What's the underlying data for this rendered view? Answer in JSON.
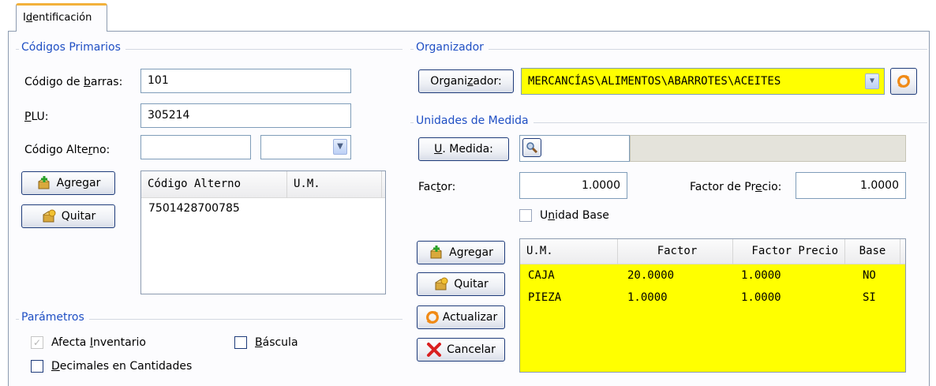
{
  "tab": {
    "label_pre": "I",
    "label_ul": "d",
    "label_post": "entificación"
  },
  "codigos": {
    "title": "Códigos Primarios",
    "barcode_label_pre": "Código de ",
    "barcode_label_ul": "b",
    "barcode_label_post": "arras:",
    "barcode_value": "101",
    "plu_label_pre": "",
    "plu_label_ul": "P",
    "plu_label_post": "LU:",
    "plu_value": "305214",
    "alt_label_pre": "Código Alte",
    "alt_label_ul": "r",
    "alt_label_post": "no:",
    "alt_value": "",
    "alt_um_value": "",
    "add_label": "Agregar",
    "remove_label": "Quitar",
    "alt_list": {
      "headers": [
        "Código Alterno",
        "U.M."
      ],
      "rows": [
        [
          "7501428700785",
          ""
        ]
      ]
    }
  },
  "parametros": {
    "title": "Parámetros",
    "afecta_pre": "Afecta ",
    "afecta_ul": "I",
    "afecta_post": "nventario",
    "afecta_checked": true,
    "bascula_ul": "B",
    "bascula_post": "áscula",
    "bascula_checked": false,
    "decimales_ul": "D",
    "decimales_post": "ecimales en Cantidades",
    "decimales_checked": false
  },
  "organizador": {
    "title": "Organizador",
    "button_pre": "Organi",
    "button_ul": "z",
    "button_post": "ador:",
    "value": "MERCANCÍAS\\ALIMENTOS\\ABARROTES\\ACEITES"
  },
  "unidades": {
    "title": "Unidades de Medida",
    "um_button_ul": "U",
    "um_button_post": ". Medida:",
    "um_value": "",
    "factor_pre": "Fac",
    "factor_ul": "t",
    "factor_post": "or:",
    "factor_value": "1.0000",
    "factor_precio_pre": "Factor de Pr",
    "factor_precio_ul": "e",
    "factor_precio_post": "cio:",
    "factor_precio_value": "1.0000",
    "unidad_base_pre": "U",
    "unidad_base_ul": "n",
    "unidad_base_post": "idad Base",
    "unidad_base_checked": false,
    "add_label": "Agregar",
    "remove_label": "Quitar",
    "update_label": "Actualizar",
    "cancel_label": "Cancelar",
    "table": {
      "headers": [
        "U.M.",
        "Factor",
        "Factor Precio",
        "Base"
      ],
      "rows": [
        [
          "CAJA",
          "20.0000",
          "1.0000",
          "NO"
        ],
        [
          "PIEZA",
          "1.0000",
          "1.0000",
          "SI"
        ]
      ]
    }
  },
  "colors": {
    "accent_blue": "#1f4fc4",
    "grid_yellow": "#ffff00",
    "tab_orange": "#f2b13b"
  }
}
